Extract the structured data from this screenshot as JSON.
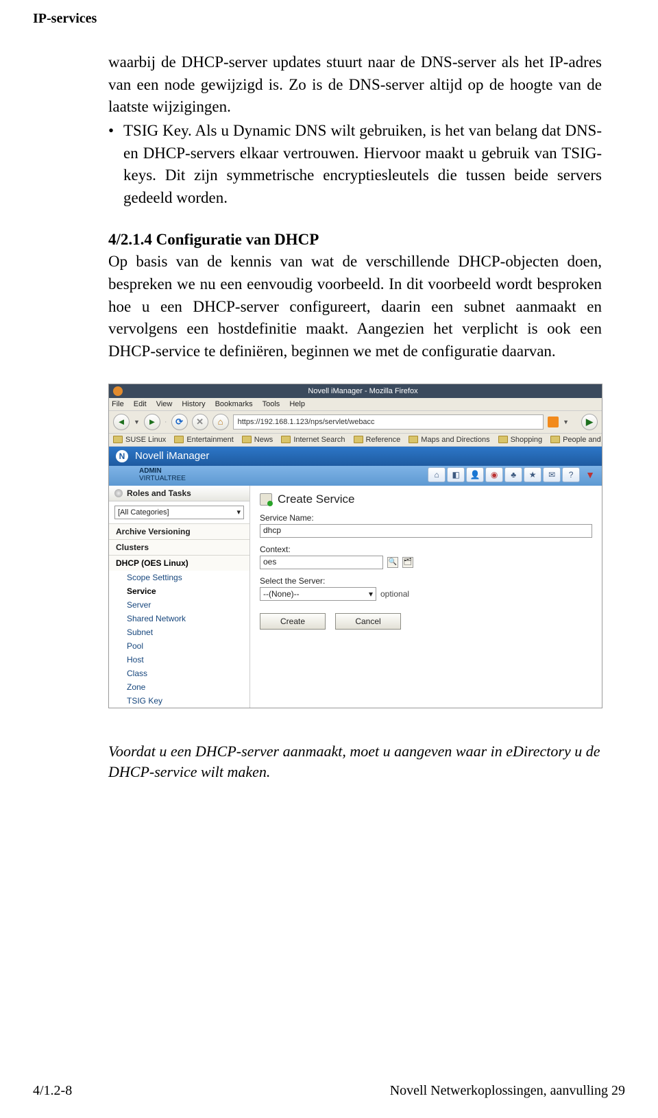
{
  "header": "IP-services",
  "para1": "waarbij de DHCP-server updates stuurt naar de DNS-server als het IP-adres van een node gewijzigd is. Zo is de DNS-server altijd op de hoogte van de laatste wijzigingen.",
  "bullet": "TSIG Key. Als u Dynamic DNS wilt gebruiken, is het van belang dat DNS- en DHCP-servers elkaar vertrouwen. Hiervoor maakt u gebruik van TSIG-keys. Dit zijn symmetrische encryptiesleutels die tussen beide servers gedeeld worden.",
  "sec_head": "4/2.1.4 Configuratie van DHCP",
  "sec_body": "Op basis van de kennis van wat de verschillende DHCP-objecten doen, bespreken we nu een eenvoudig voorbeeld. In dit voorbeeld wordt besproken hoe u een DHCP-server configureert, daarin een subnet aanmaakt en vervolgens een hostdefinitie maakt. Aangezien het verplicht is ook een DHCP-service te definiëren, beginnen we met de configuratie daarvan.",
  "titlebar": "Novell iManager - Mozilla Firefox",
  "menu": [
    "File",
    "Edit",
    "View",
    "History",
    "Bookmarks",
    "Tools",
    "Help"
  ],
  "url": "https://192.168.1.123/nps/servlet/webacc",
  "bookmarks": [
    "SUSE Linux",
    "Entertainment",
    "News",
    "Internet Search",
    "Reference",
    "Maps and Directions",
    "Shopping",
    "People and Compan..."
  ],
  "novell_title": "Novell iManager",
  "admin_label": "ADMIN",
  "tree_label": "VIRTUALTREE",
  "sidebar_tab": "Roles and Tasks",
  "sidebar_select": "[All Categories]",
  "groups": {
    "g1": "Archive Versioning",
    "g2": "Clusters",
    "g3": "DHCP (OES Linux)"
  },
  "items": [
    "Scope Settings",
    "Service",
    "Server",
    "Shared Network",
    "Subnet",
    "Pool",
    "Host",
    "Class",
    "Zone",
    "TSIG Key"
  ],
  "create_service": "Create Service",
  "f1_label": "Service Name:",
  "f1_value": "dhcp",
  "f2_label": "Context:",
  "f2_value": "oes",
  "f3_label": "Select the Server:",
  "f3_value": "--(None)--",
  "f3_note": "optional",
  "btn_create": "Create",
  "btn_cancel": "Cancel",
  "caption": "Voordat u een DHCP-server aanmaakt, moet u aangeven waar in eDirectory u de DHCP-service wilt maken.",
  "footer_left": "4/1.2-8",
  "footer_right": "Novell Netwerkoplossingen, aanvulling 29"
}
